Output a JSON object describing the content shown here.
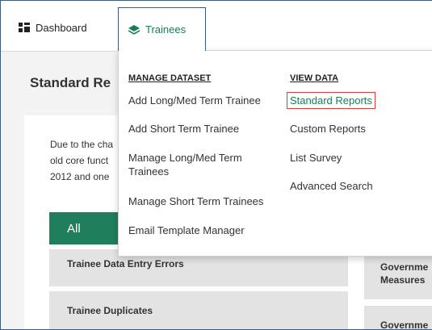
{
  "nav": {
    "dashboard": {
      "label": "Dashboard",
      "icon": "dashboard-grid-icon"
    },
    "trainees": {
      "label": "Trainees",
      "icon": "layers-icon",
      "color": "#1a7c5a"
    }
  },
  "page": {
    "title": "Standard Re",
    "intro_lines": [
      "Due to the cha",
      "old core funct",
      "2012 and one"
    ]
  },
  "dropdown": {
    "manage": {
      "heading": "MANAGE DATASET",
      "items": [
        "Add Long/Med Term Trainee",
        "Add Short Term Trainee",
        "Manage Long/Med Term Trainees",
        "Manage Short Term Trainees",
        "Email Template Manager"
      ]
    },
    "view": {
      "heading": "VIEW DATA",
      "items": [
        "Standard Reports",
        "Custom Reports",
        "List Survey",
        "Advanced Search"
      ],
      "selected": "Standard Reports"
    }
  },
  "tabs": {
    "all": "All"
  },
  "reports": {
    "row1": "Trainee Data Entry Errors",
    "row2": "Trainee Duplicates",
    "row3_line1": "Governme",
    "row3_line2": "Measures",
    "row4": "Governme"
  },
  "colors": {
    "accent": "#1f7f5c",
    "highlight_border": "#d93a3a"
  }
}
